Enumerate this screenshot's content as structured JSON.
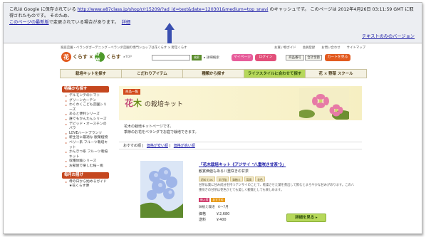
{
  "cache": {
    "line1_pre": "これは Google に保存されている",
    "url": "http://www.e87class.jp/shop/r/r15209/?ad_id=text&date=120301&medium=top_snavi",
    "line1_post": "のキャッシュです。 このページは 2012年4月26日 03:11:59 GMT に取得されたものです。 そのため、",
    "line2_link": "このページの最新版",
    "line2_post": "で変更されている場合があります。",
    "details": "詳細",
    "text_only": "テキストのみのバージョン"
  },
  "header": {
    "topline": "家庭菜園・ベランダガーデニング・ベランダ菜園の専門ショップは花くらす × 野菜くらす",
    "toplinks": [
      "お買い物ガイド",
      "会員登録",
      "お問い合わせ",
      "サイトマップ"
    ],
    "logo_hana": "花",
    "logo_text1": "くらす",
    "logo_x": "×",
    "logo_yasai": "野菜",
    "logo_text2": "くらす",
    "logo_top": "▸TOP",
    "search_btn": "検索",
    "detail_search": "▸ 詳細検索",
    "mypage": "マイページ",
    "login": "ログイン",
    "box1": "商品番号",
    "box2": "合計金額",
    "cart": "カートを見る"
  },
  "nav": [
    "栽培キットを探す",
    "こだわりアイテム",
    "種類から探す",
    "ライフスタイルに合わせて探す",
    "花 × 野菜 スクール"
  ],
  "sidebar": {
    "h1": "特集から探す",
    "items": [
      "デルモンテのトマト",
      "グリーンカーテン",
      "わくわくこども菜園シリーズ",
      "あると便利シリーズ",
      "誰でもかんたんシリーズ",
      "デビッド・オースチンのバラ",
      "LOVEハートプランツ",
      "新生活に最適な 観葉植物",
      "ベリー系 フルーツ栽培キット",
      "かんきつ系 フルーツ栽培キット",
      "収穫体験シリーズ",
      "お部屋で楽しむ桜・桃"
    ],
    "h2": "毎月お届け",
    "items2": [
      "母の日から始めるガイド ★花くらす便"
    ]
  },
  "banner": {
    "new": "商品一覧",
    "title_hana": "花",
    "title_ki": "木",
    "title_rest": "の栽培キット"
  },
  "desc": [
    "花木の栽培キットページです。",
    "季節のお花をベランダでお庭で栽培できます。"
  ],
  "sort": {
    "label": "おすすめ順",
    "opt1": "価格が安い順",
    "opt2": "価格が高い順"
  },
  "product": {
    "name": "「花木栽培キット《アジサイ \"八重咲き甘茶\"》」",
    "sub": "観賞価値もある八重咲きの甘茶",
    "tags": [
      "初めてOK",
      "半日陰",
      "鉢植え",
      "背高",
      "花色"
    ],
    "desc": "甘茶は葉に甘み成分を持つアジサイのことで、乾燥させた葉を煮出して飲むとまろやかな甘みがあります。この八重咲きの甘茶は花色がとても美しく観賞としても楽しめます。",
    "badge1": "新入荷",
    "badge2": "おすすめ",
    "size": "鉢植え栽培　6〜7月",
    "price_label": "価格",
    "price": "￥2,680",
    "ship_label": "送料",
    "ship": "￥400",
    "detail_btn": "詳細を見る ▸"
  }
}
